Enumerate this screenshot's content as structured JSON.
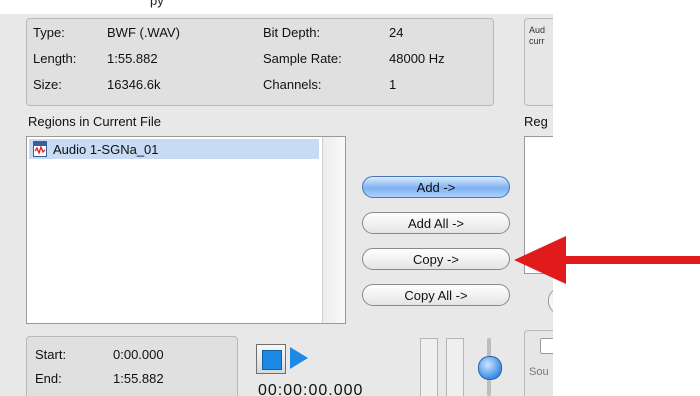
{
  "top_clip": {
    "text": "py"
  },
  "file_info": {
    "type_label": "Type:",
    "type_value": "BWF (.WAV)",
    "length_label": "Length:",
    "length_value": "1:55.882",
    "size_label": "Size:",
    "size_value": "16346.6k",
    "bit_depth_label": "Bit Depth:",
    "bit_depth_value": "24",
    "sample_rate_label": "Sample Rate:",
    "sample_rate_value": "48000 Hz",
    "channels_label": "Channels:",
    "channels_value": "1"
  },
  "right_info": {
    "text": "Aud\ncurr"
  },
  "regions": {
    "label": "Regions in Current File",
    "items": [
      {
        "name": "Audio 1-SGNa_01"
      }
    ]
  },
  "right_regions": {
    "label": "Reg"
  },
  "buttons": {
    "add": "Add ->",
    "add_all": "Add All ->",
    "copy": "Copy ->",
    "copy_all": "Copy All ->"
  },
  "time": {
    "start_label": "Start:",
    "start_value": "0:00.000",
    "end_label": "End:",
    "end_value": "1:55.882"
  },
  "timecode": {
    "value": "00:00:00.000"
  },
  "right_bottom": {
    "text": "Sou"
  },
  "colors": {
    "accent": "#1e88e5",
    "annotation_arrow": "#e11b1b"
  }
}
